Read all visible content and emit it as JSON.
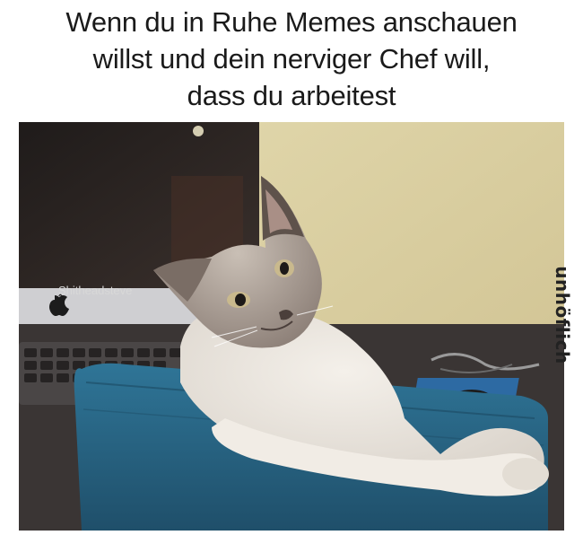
{
  "caption": {
    "line1": "Wenn du in Ruhe Memes anschauen",
    "line2": "willst und dein nerviger Chef will,",
    "line3": "dass du arbeitest"
  },
  "photo": {
    "credit_watermark": "Shitheadsteve",
    "subject": "cat-on-office-chair"
  },
  "watermark": {
    "text": "unhöflich"
  },
  "colors": {
    "wall": "#d9cfa0",
    "chair": "#2c6a8c",
    "cat_fur": "#e8e3dc",
    "cat_points": "#6b6058",
    "desk": "#3a3534"
  }
}
